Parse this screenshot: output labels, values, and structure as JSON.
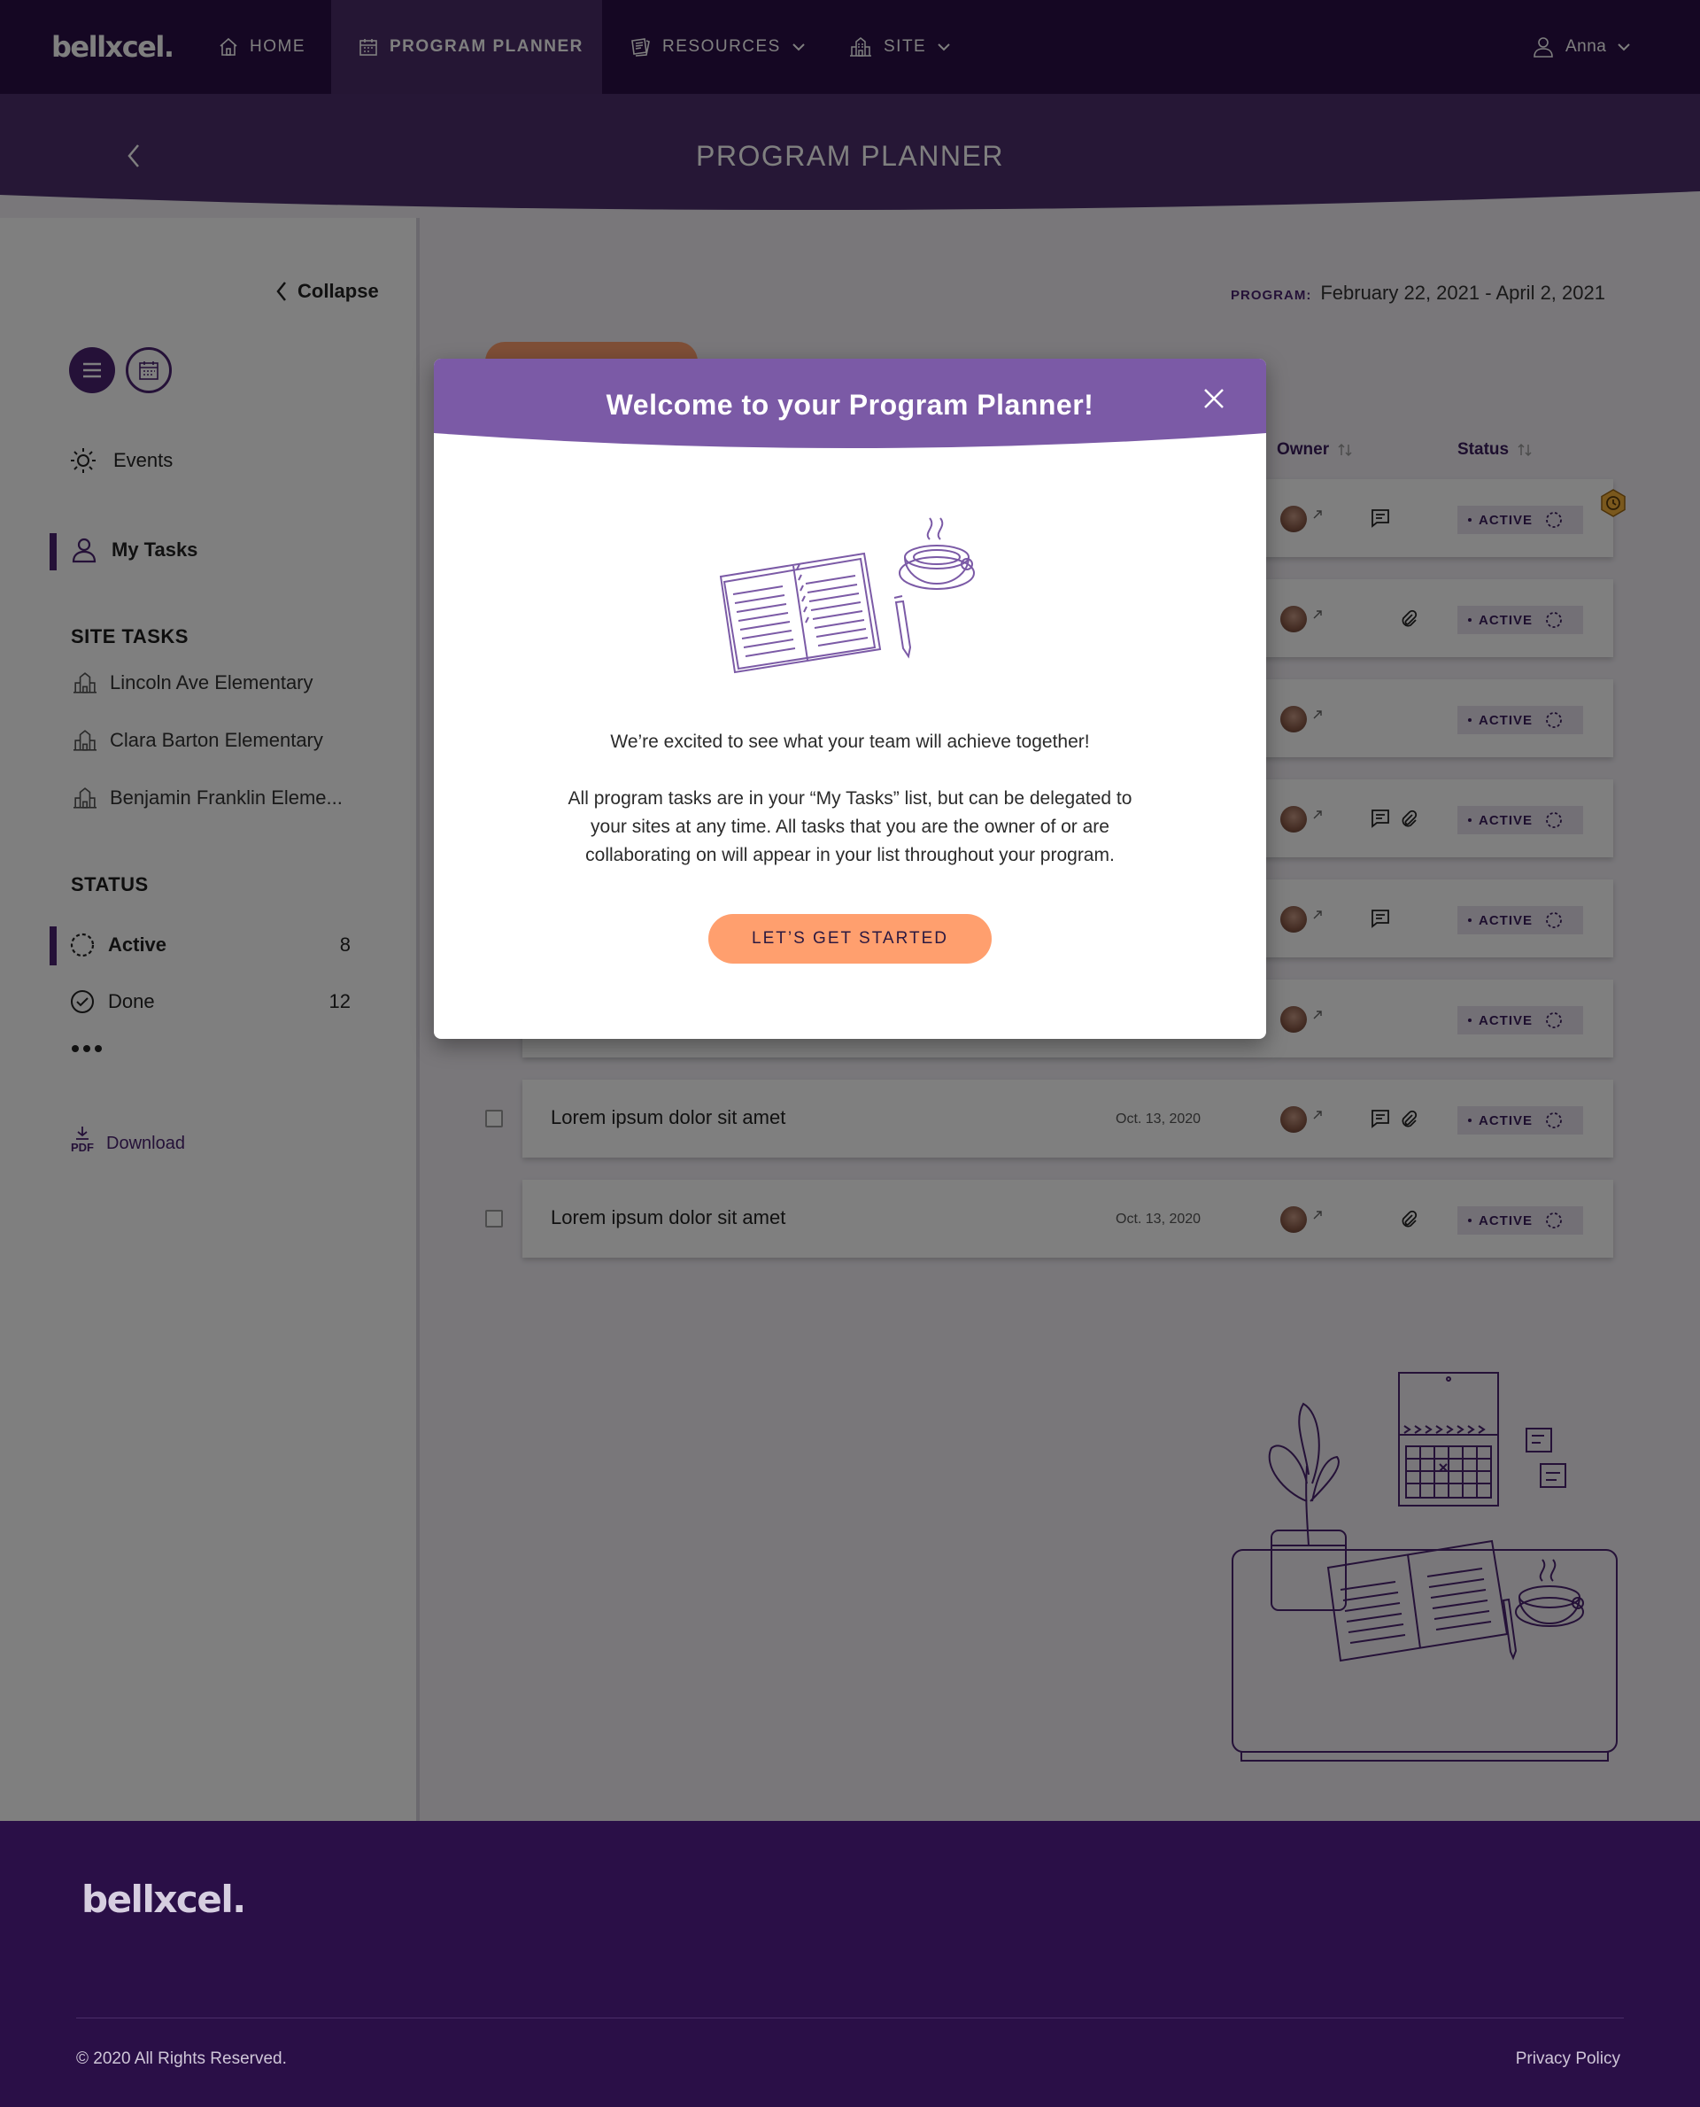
{
  "nav": {
    "logo": "bellxcel.",
    "items": [
      {
        "label": "HOME",
        "icon": "home-icon"
      },
      {
        "label": "PROGRAM PLANNER",
        "icon": "calendar-icon"
      },
      {
        "label": "RESOURCES",
        "icon": "resources-icon"
      },
      {
        "label": "SITE",
        "icon": "building-icon"
      }
    ],
    "user": "Anna"
  },
  "header": {
    "title": "PROGRAM PLANNER"
  },
  "sidebar": {
    "collapse": "Collapse",
    "events": "Events",
    "my_tasks": "My Tasks",
    "site_tasks_heading": "SITE TASKS",
    "sites": [
      "Lincoln Ave Elementary",
      "Clara Barton Elementary",
      "Benjamin Franklin Eleme..."
    ],
    "status_heading": "STATUS",
    "status": [
      {
        "label": "Active",
        "count": "8"
      },
      {
        "label": "Done",
        "count": "12"
      }
    ],
    "download_badge": "PDF",
    "download": "Download"
  },
  "main": {
    "program_label": "PROGRAM:",
    "program_dates": "February 22, 2021 - April 2, 2021",
    "columns": {
      "owner": "Owner",
      "status": "Status"
    },
    "rows": [
      {
        "title": "",
        "date": "",
        "status": "ACTIVE",
        "comment": true,
        "attach": false
      },
      {
        "title": "",
        "date": "",
        "status": "ACTIVE",
        "comment": false,
        "attach": true
      },
      {
        "title": "",
        "date": "",
        "status": "ACTIVE",
        "comment": false,
        "attach": false
      },
      {
        "title": "",
        "date": "",
        "status": "ACTIVE",
        "comment": true,
        "attach": true
      },
      {
        "title": "",
        "date": "",
        "status": "ACTIVE",
        "comment": true,
        "attach": false
      },
      {
        "title": "",
        "date": "",
        "status": "ACTIVE",
        "comment": false,
        "attach": false
      },
      {
        "title": "Lorem ipsum dolor sit amet",
        "date": "Oct. 13, 2020",
        "status": "ACTIVE",
        "comment": true,
        "attach": true
      },
      {
        "title": "Lorem ipsum dolor sit amet",
        "date": "Oct. 13, 2020",
        "status": "ACTIVE",
        "comment": false,
        "attach": true
      }
    ]
  },
  "modal": {
    "title": "Welcome to your Program Planner!",
    "line1": "We’re excited to see what your team will achieve together!",
    "para": [
      "All program tasks are in your “My Tasks” list, but can be delegated to",
      "your sites at any time. All tasks that you are the owner of or are",
      "collaborating on will appear in your list throughout your program."
    ],
    "cta": "LET’S GET STARTED"
  },
  "footer": {
    "logo": "bellxcel.",
    "copyright": "© 2020 All Rights Reserved.",
    "privacy": "Privacy Policy"
  },
  "colors": {
    "nav": "#2a0f47",
    "band": "#4d2f6d",
    "modal_header": "#7b5aa6",
    "cta": "#ff9f6e"
  }
}
